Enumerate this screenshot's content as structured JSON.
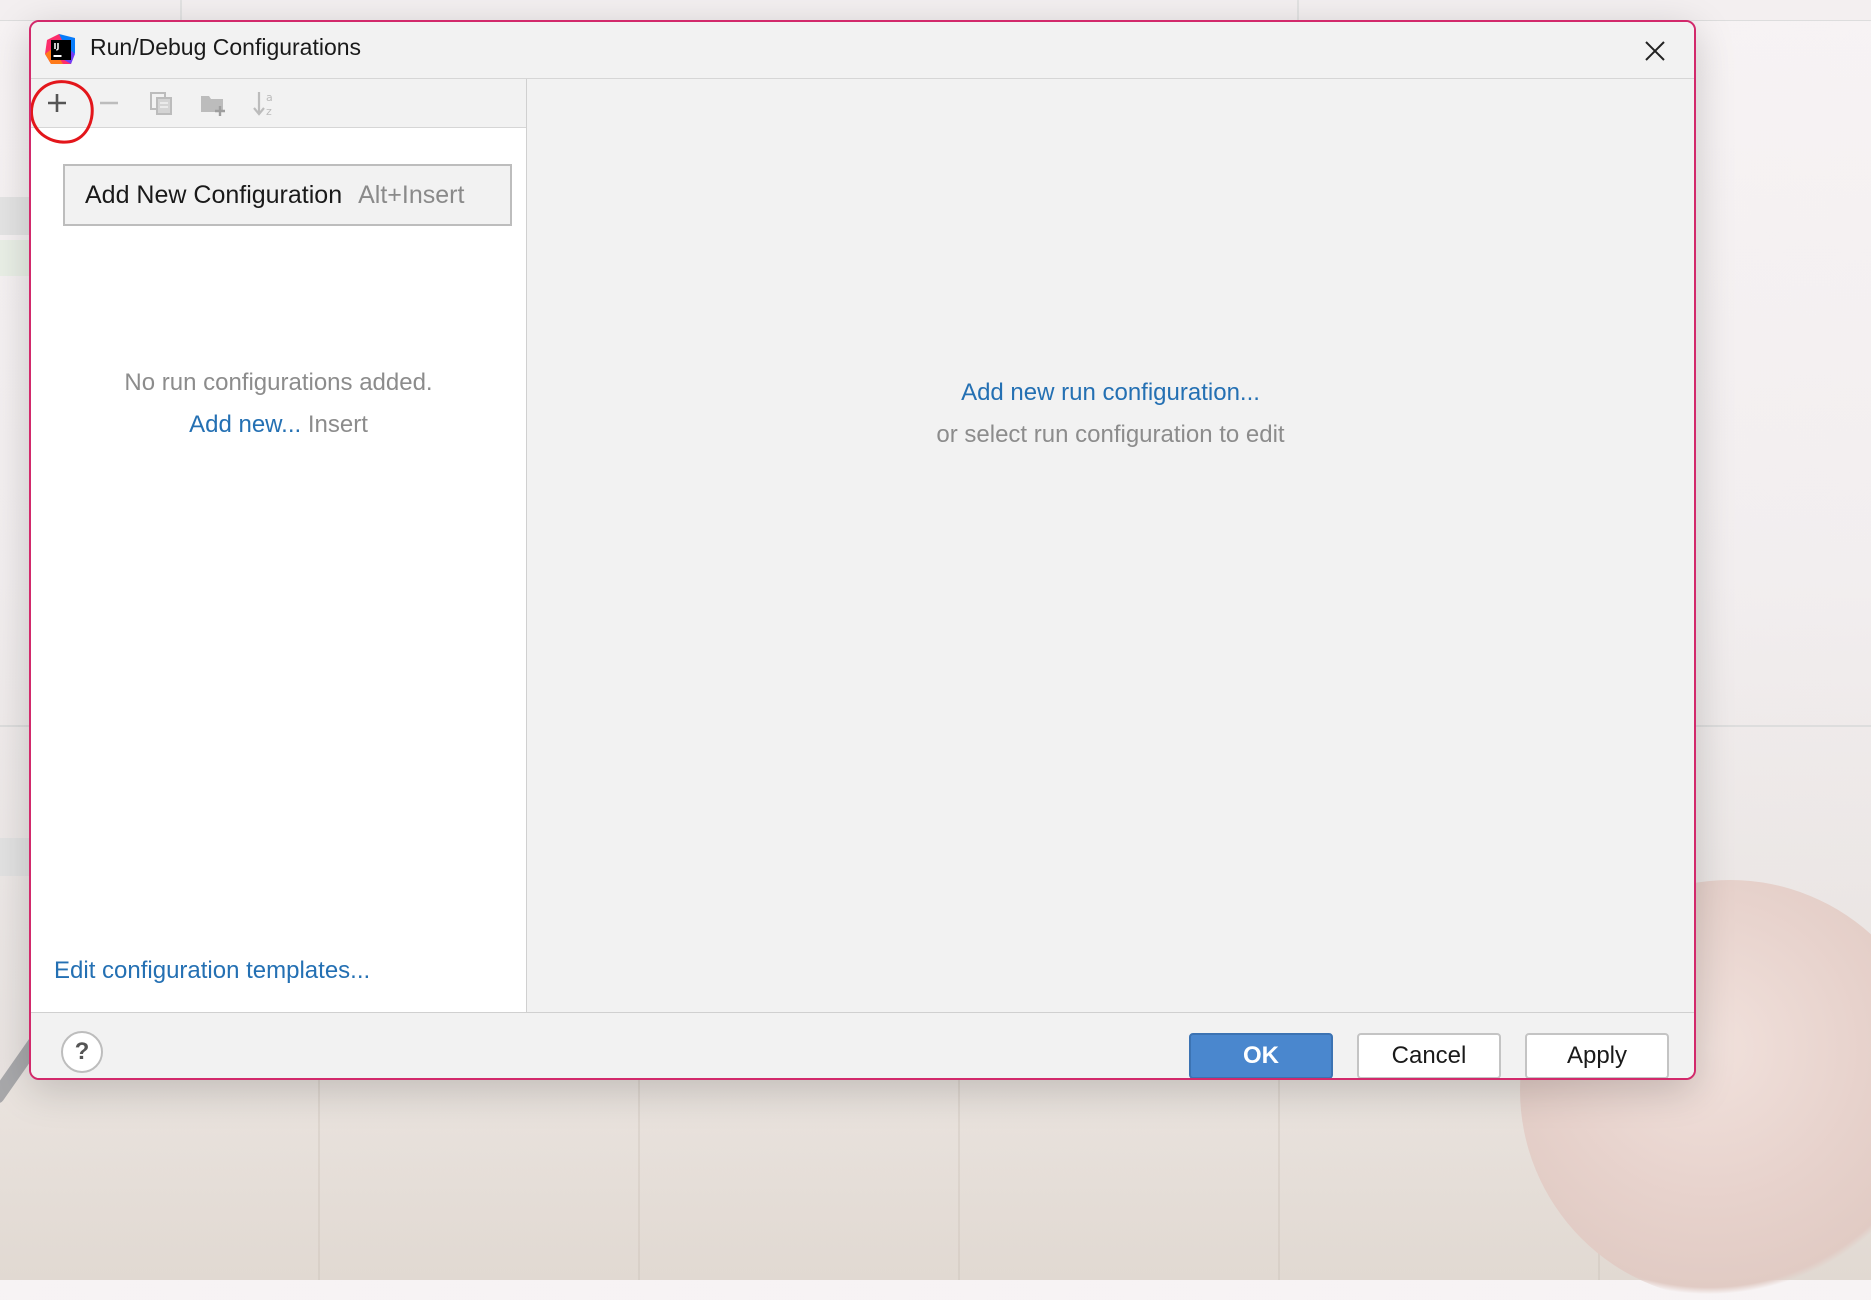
{
  "dialog": {
    "title": "Run/Debug Configurations",
    "icons": {
      "app": "intellij-idea-icon",
      "close": "close-icon"
    }
  },
  "toolbar": {
    "buttons": [
      {
        "name": "add-configuration-button",
        "icon": "plus-icon",
        "enabled": true,
        "highlighted": true
      },
      {
        "name": "remove-configuration-button",
        "icon": "minus-icon",
        "enabled": false
      },
      {
        "name": "copy-configuration-button",
        "icon": "copy-icon",
        "enabled": false
      },
      {
        "name": "new-folder-button",
        "icon": "folder-add-icon",
        "enabled": false
      },
      {
        "name": "sort-button",
        "icon": "sort-alpha-icon",
        "enabled": false
      }
    ],
    "highlight_color": "#e3161b"
  },
  "popup": {
    "label": "Add New Configuration",
    "shortcut": "Alt+Insert"
  },
  "left_panel": {
    "empty_message": "No run configurations added.",
    "add_new_link": "Add new...",
    "add_new_hint": "Insert",
    "templates_link": "Edit configuration templates..."
  },
  "right_panel": {
    "add_link": "Add new run configuration...",
    "hint": "or select run configuration to edit"
  },
  "footer": {
    "help_label": "?",
    "ok_label": "OK",
    "cancel_label": "Cancel",
    "apply_label": "Apply"
  },
  "colors": {
    "dialog_border": "#d2296b",
    "link": "#2470b3",
    "primary_button": "#4a87ce"
  }
}
